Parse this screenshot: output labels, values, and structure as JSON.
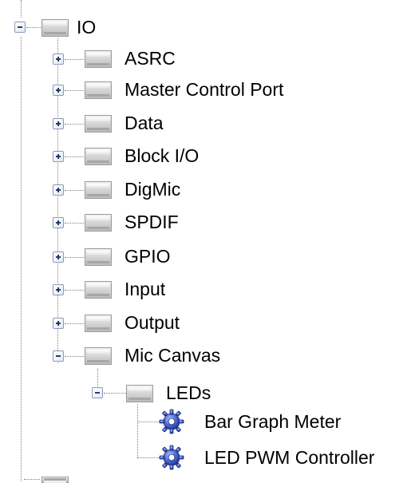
{
  "tree": {
    "root": {
      "label": "IO",
      "expanded": true
    },
    "io_children": [
      {
        "label": "ASRC",
        "expanded": false
      },
      {
        "label": "Master Control Port",
        "expanded": false
      },
      {
        "label": "Data",
        "expanded": false
      },
      {
        "label": "Block I/O",
        "expanded": false
      },
      {
        "label": "DigMic",
        "expanded": false
      },
      {
        "label": "SPDIF",
        "expanded": false
      },
      {
        "label": "GPIO",
        "expanded": false
      },
      {
        "label": "Input",
        "expanded": false
      },
      {
        "label": "Output",
        "expanded": false
      },
      {
        "label": "Mic Canvas",
        "expanded": true
      }
    ],
    "mic_canvas_children": [
      {
        "label": "LEDs",
        "expanded": true
      }
    ],
    "leds_children": [
      {
        "label": "Bar Graph Meter",
        "icon": "gear-icon"
      },
      {
        "label": "LED PWM Controller",
        "icon": "gear-icon"
      }
    ]
  }
}
